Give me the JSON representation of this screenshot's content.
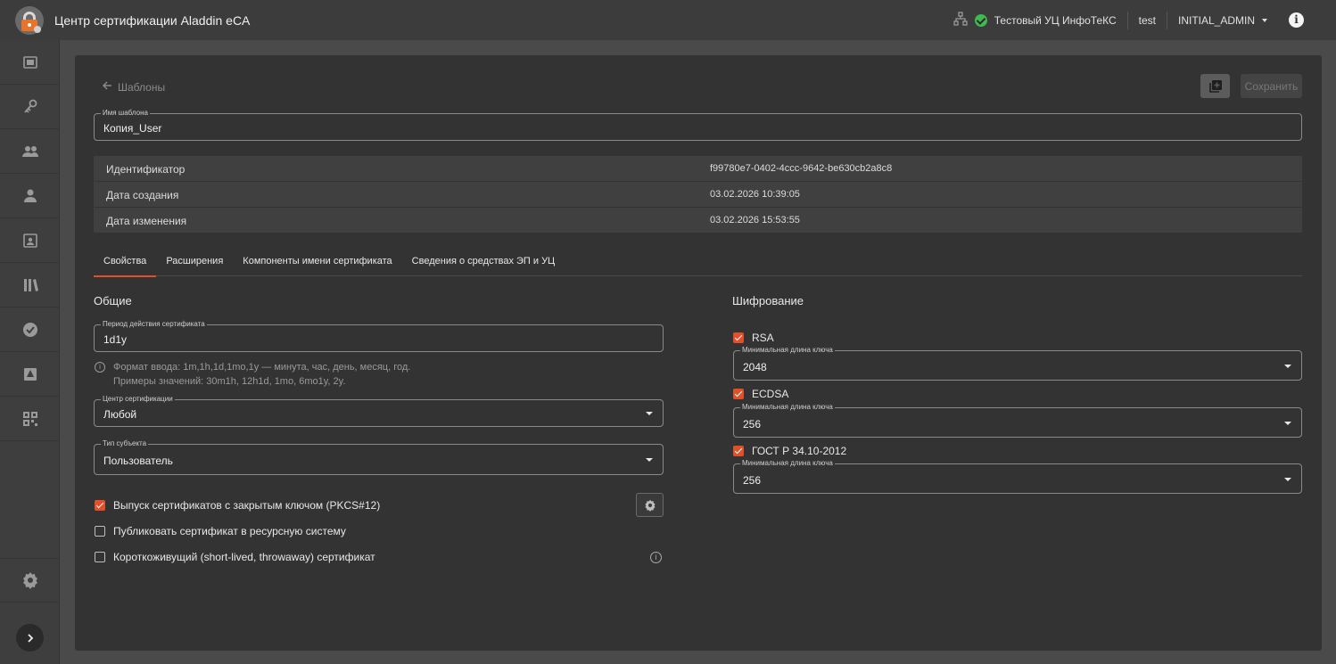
{
  "app": {
    "title": "Центр сертификации Aladdin eCA"
  },
  "topbar": {
    "ca_name": "Тестовый УЦ ИнфоТеКС",
    "user": "test",
    "role": "INITIAL_ADMIN"
  },
  "sidebar": {
    "items": [
      "dashboard-icon",
      "key-icon",
      "users-icon",
      "user-icon",
      "id-card-icon",
      "library-icon",
      "verified-icon",
      "certificate-icon",
      "qr-code-icon"
    ],
    "settings": "gear-icon"
  },
  "page": {
    "back_label": "Шаблоны",
    "save_label": "Сохранить",
    "template_name": {
      "label": "Имя шаблона",
      "value": "Копия_User"
    },
    "info": [
      {
        "key": "Идентификатор",
        "value": "f99780e7-0402-4ccc-9642-be630cb2a8c8"
      },
      {
        "key": "Дата создания",
        "value": "03.02.2026 10:39:05"
      },
      {
        "key": "Дата изменения",
        "value": "03.02.2026 15:53:55"
      }
    ],
    "tabs": [
      "Свойства",
      "Расширения",
      "Компоненты имени сертификата",
      "Сведения о средствах ЭП и УЦ"
    ],
    "active_tab": 0
  },
  "general": {
    "title": "Общие",
    "period": {
      "label": "Период действия сертификата",
      "value": "1d1y"
    },
    "hint_line1": "Формат ввода: 1m,1h,1d,1mo,1y — минута, час, день, месяц, год.",
    "hint_line2": "Примеры значений: 30m1h, 12h1d, 1mo, 6mo1y, 2y.",
    "ca": {
      "label": "Центр сертификации",
      "value": "Любой"
    },
    "subject": {
      "label": "Тип субъекта",
      "value": "Пользователь"
    },
    "checks": [
      {
        "label": "Выпуск сертификатов с закрытым ключом (PKCS#12)",
        "checked": true
      },
      {
        "label": "Публиковать сертификат в ресурсную систему",
        "checked": false
      },
      {
        "label": "Короткоживущий (short-lived, throwaway) сертификат",
        "checked": false
      }
    ]
  },
  "encryption": {
    "title": "Шифрование",
    "algorithms": [
      {
        "name": "RSA",
        "checked": true,
        "key_label": "Минимальная длина ключа",
        "key_value": "2048"
      },
      {
        "name": "ECDSA",
        "checked": true,
        "key_label": "Минимальная длина ключа",
        "key_value": "256"
      },
      {
        "name": "ГОСТ Р 34.10-2012",
        "checked": true,
        "key_label": "Минимальная длина ключа",
        "key_value": "256"
      }
    ]
  },
  "colors": {
    "accent": "#e0502a",
    "ok": "#3fb950",
    "card": "#333333",
    "background": "#4a4a4a"
  }
}
